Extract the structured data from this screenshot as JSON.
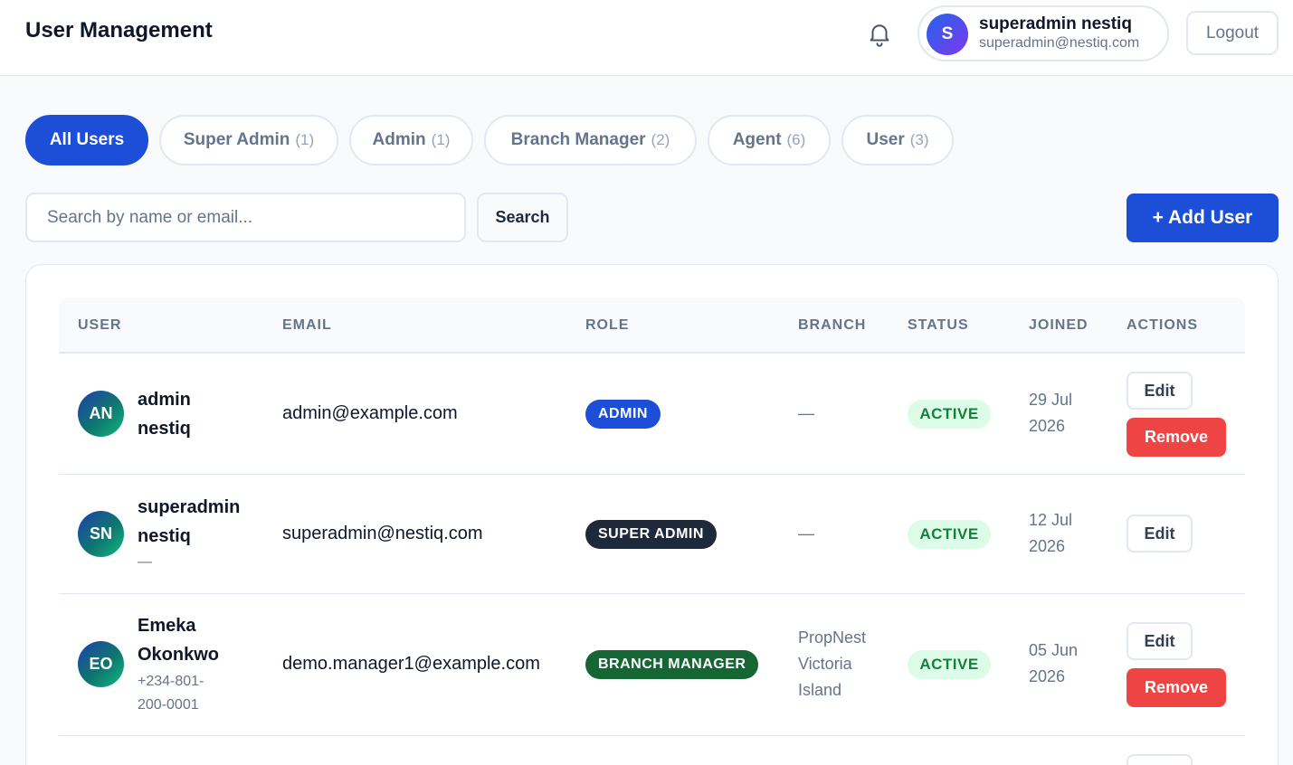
{
  "header": {
    "title": "User Management",
    "bell_icon": "bell-icon",
    "profile": {
      "initial": "S",
      "name": "superadmin nestiq",
      "email": "superadmin@nestiq.com"
    },
    "logout_label": "Logout"
  },
  "tabs": [
    {
      "label": "All Users",
      "count": "",
      "active": true
    },
    {
      "label": "Super Admin",
      "count": "(1)",
      "active": false
    },
    {
      "label": "Admin",
      "count": "(1)",
      "active": false
    },
    {
      "label": "Branch Manager",
      "count": "(2)",
      "active": false
    },
    {
      "label": "Agent",
      "count": "(6)",
      "active": false
    },
    {
      "label": "User",
      "count": "(3)",
      "active": false
    }
  ],
  "search": {
    "placeholder": "Search by name or email...",
    "value": "",
    "button_label": "Search"
  },
  "add_user_label": "+ Add User",
  "table": {
    "columns": [
      "USER",
      "EMAIL",
      "ROLE",
      "BRANCH",
      "STATUS",
      "JOINED",
      "ACTIONS"
    ],
    "rows": [
      {
        "initials": "AN",
        "name_line1": "admin",
        "name_line2": "nestiq",
        "sub1": "",
        "sub2": "",
        "email": "admin@example.com",
        "role": "ADMIN",
        "role_color": "#1d4ed8",
        "branch_line1": "—",
        "branch_line2": "",
        "branch_line3": "",
        "status": "ACTIVE",
        "joined_line1": "29 Jul",
        "joined_line2": "2026",
        "edit_label": "Edit",
        "remove_label": "Remove"
      },
      {
        "initials": "SN",
        "name_line1": "superadmin",
        "name_line2": "nestiq",
        "sub1": "—",
        "sub2": "",
        "email": "superadmin@nestiq.com",
        "role": "SUPER ADMIN",
        "role_color": "#1e293b",
        "branch_line1": "—",
        "branch_line2": "",
        "branch_line3": "",
        "status": "ACTIVE",
        "joined_line1": "12 Jul",
        "joined_line2": "2026",
        "edit_label": "Edit",
        "remove_label": ""
      },
      {
        "initials": "EO",
        "name_line1": "Emeka",
        "name_line2": "Okonkwo",
        "sub1": "+234-801-",
        "sub2": "200-0001",
        "email": "demo.manager1@example.com",
        "role": "BRANCH MANAGER",
        "role_color": "#166534",
        "branch_line1": "PropNest",
        "branch_line2": "Victoria",
        "branch_line3": "Island",
        "status": "ACTIVE",
        "joined_line1": "05 Jun",
        "joined_line2": "2026",
        "edit_label": "Edit",
        "remove_label": "Remove"
      }
    ]
  }
}
